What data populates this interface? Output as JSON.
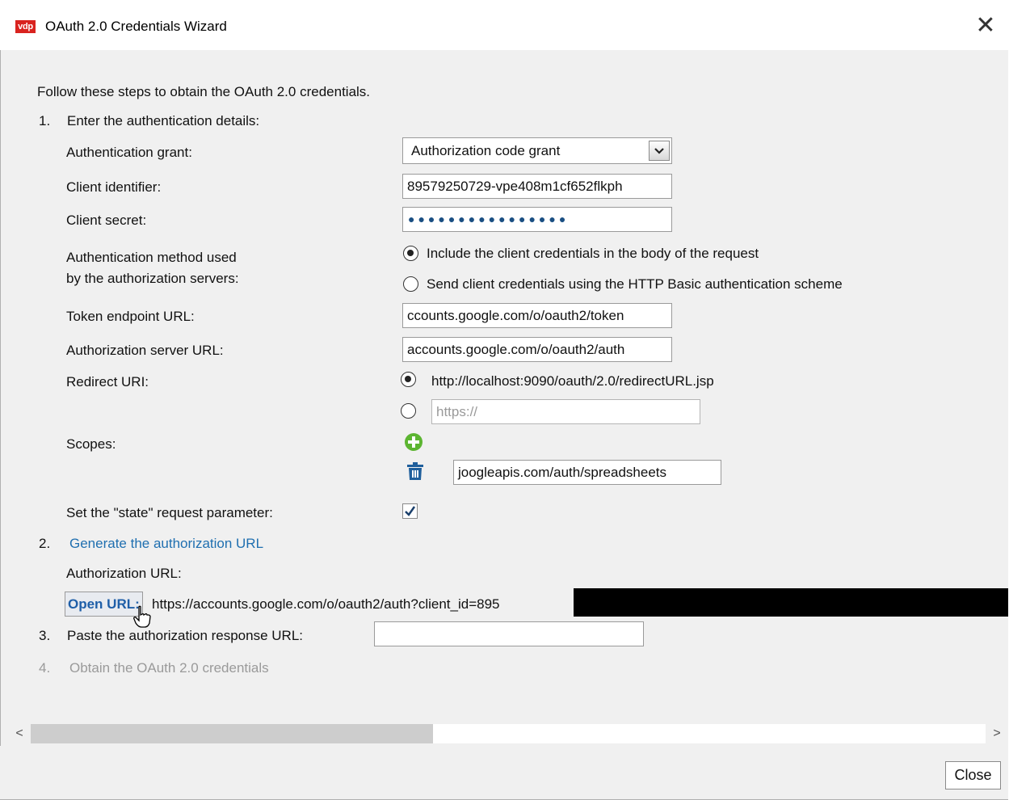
{
  "window": {
    "title": "OAuth 2.0 Credentials Wizard",
    "logo_text": "vdp"
  },
  "intro": "Follow these steps to obtain the OAuth 2.0 credentials.",
  "step1": {
    "number": "1.",
    "label": "Enter the authentication details:",
    "grant_label": "Authentication grant:",
    "grant_value": "Authorization code grant",
    "client_id_label": "Client identifier:",
    "client_id_value": "89579250729-vpe408m1cf652flkph",
    "client_secret_label": "Client secret:",
    "client_secret_mask": "●●●●●●●●●●●●●●●●",
    "auth_method_label_1": "Authentication method used",
    "auth_method_label_2": "by the authorization servers:",
    "auth_method_option_1": "Include the client credentials in the body of the request",
    "auth_method_option_2": "Send client credentials using the HTTP Basic authentication scheme",
    "token_url_label": "Token endpoint URL:",
    "token_url_value": "ccounts.google.com/o/oauth2/token",
    "auth_server_label": "Authorization server URL:",
    "auth_server_value": "accounts.google.com/o/oauth2/auth",
    "redirect_label": "Redirect URI:",
    "redirect_option_1": "http://localhost:9090/oauth/2.0/redirectURL.jsp",
    "redirect_custom_placeholder": "https://",
    "scopes_label": "Scopes:",
    "scope_value": "joogleapis.com/auth/spreadsheets",
    "state_label": "Set the \"state\" request parameter:"
  },
  "step2": {
    "number": "2.",
    "label": "Generate the authorization URL",
    "auth_url_label": "Authorization URL:",
    "open_url_label": "Open URL:",
    "auth_url_value": "https://accounts.google.com/o/oauth2/auth?client_id=895"
  },
  "step3": {
    "number": "3.",
    "label": "Paste the authorization response URL:"
  },
  "step4": {
    "number": "4.",
    "label": "Obtain the OAuth 2.0 credentials"
  },
  "buttons": {
    "close": "Close"
  },
  "icons": {
    "add": "add-icon",
    "delete": "trash-icon",
    "close": "close-icon",
    "cursor": "hand-cursor-icon"
  },
  "colors": {
    "link": "#1f6fb0",
    "add_icon": "#5cb531",
    "trash_icon": "#1f5f9c",
    "logo": "#d9231f"
  }
}
